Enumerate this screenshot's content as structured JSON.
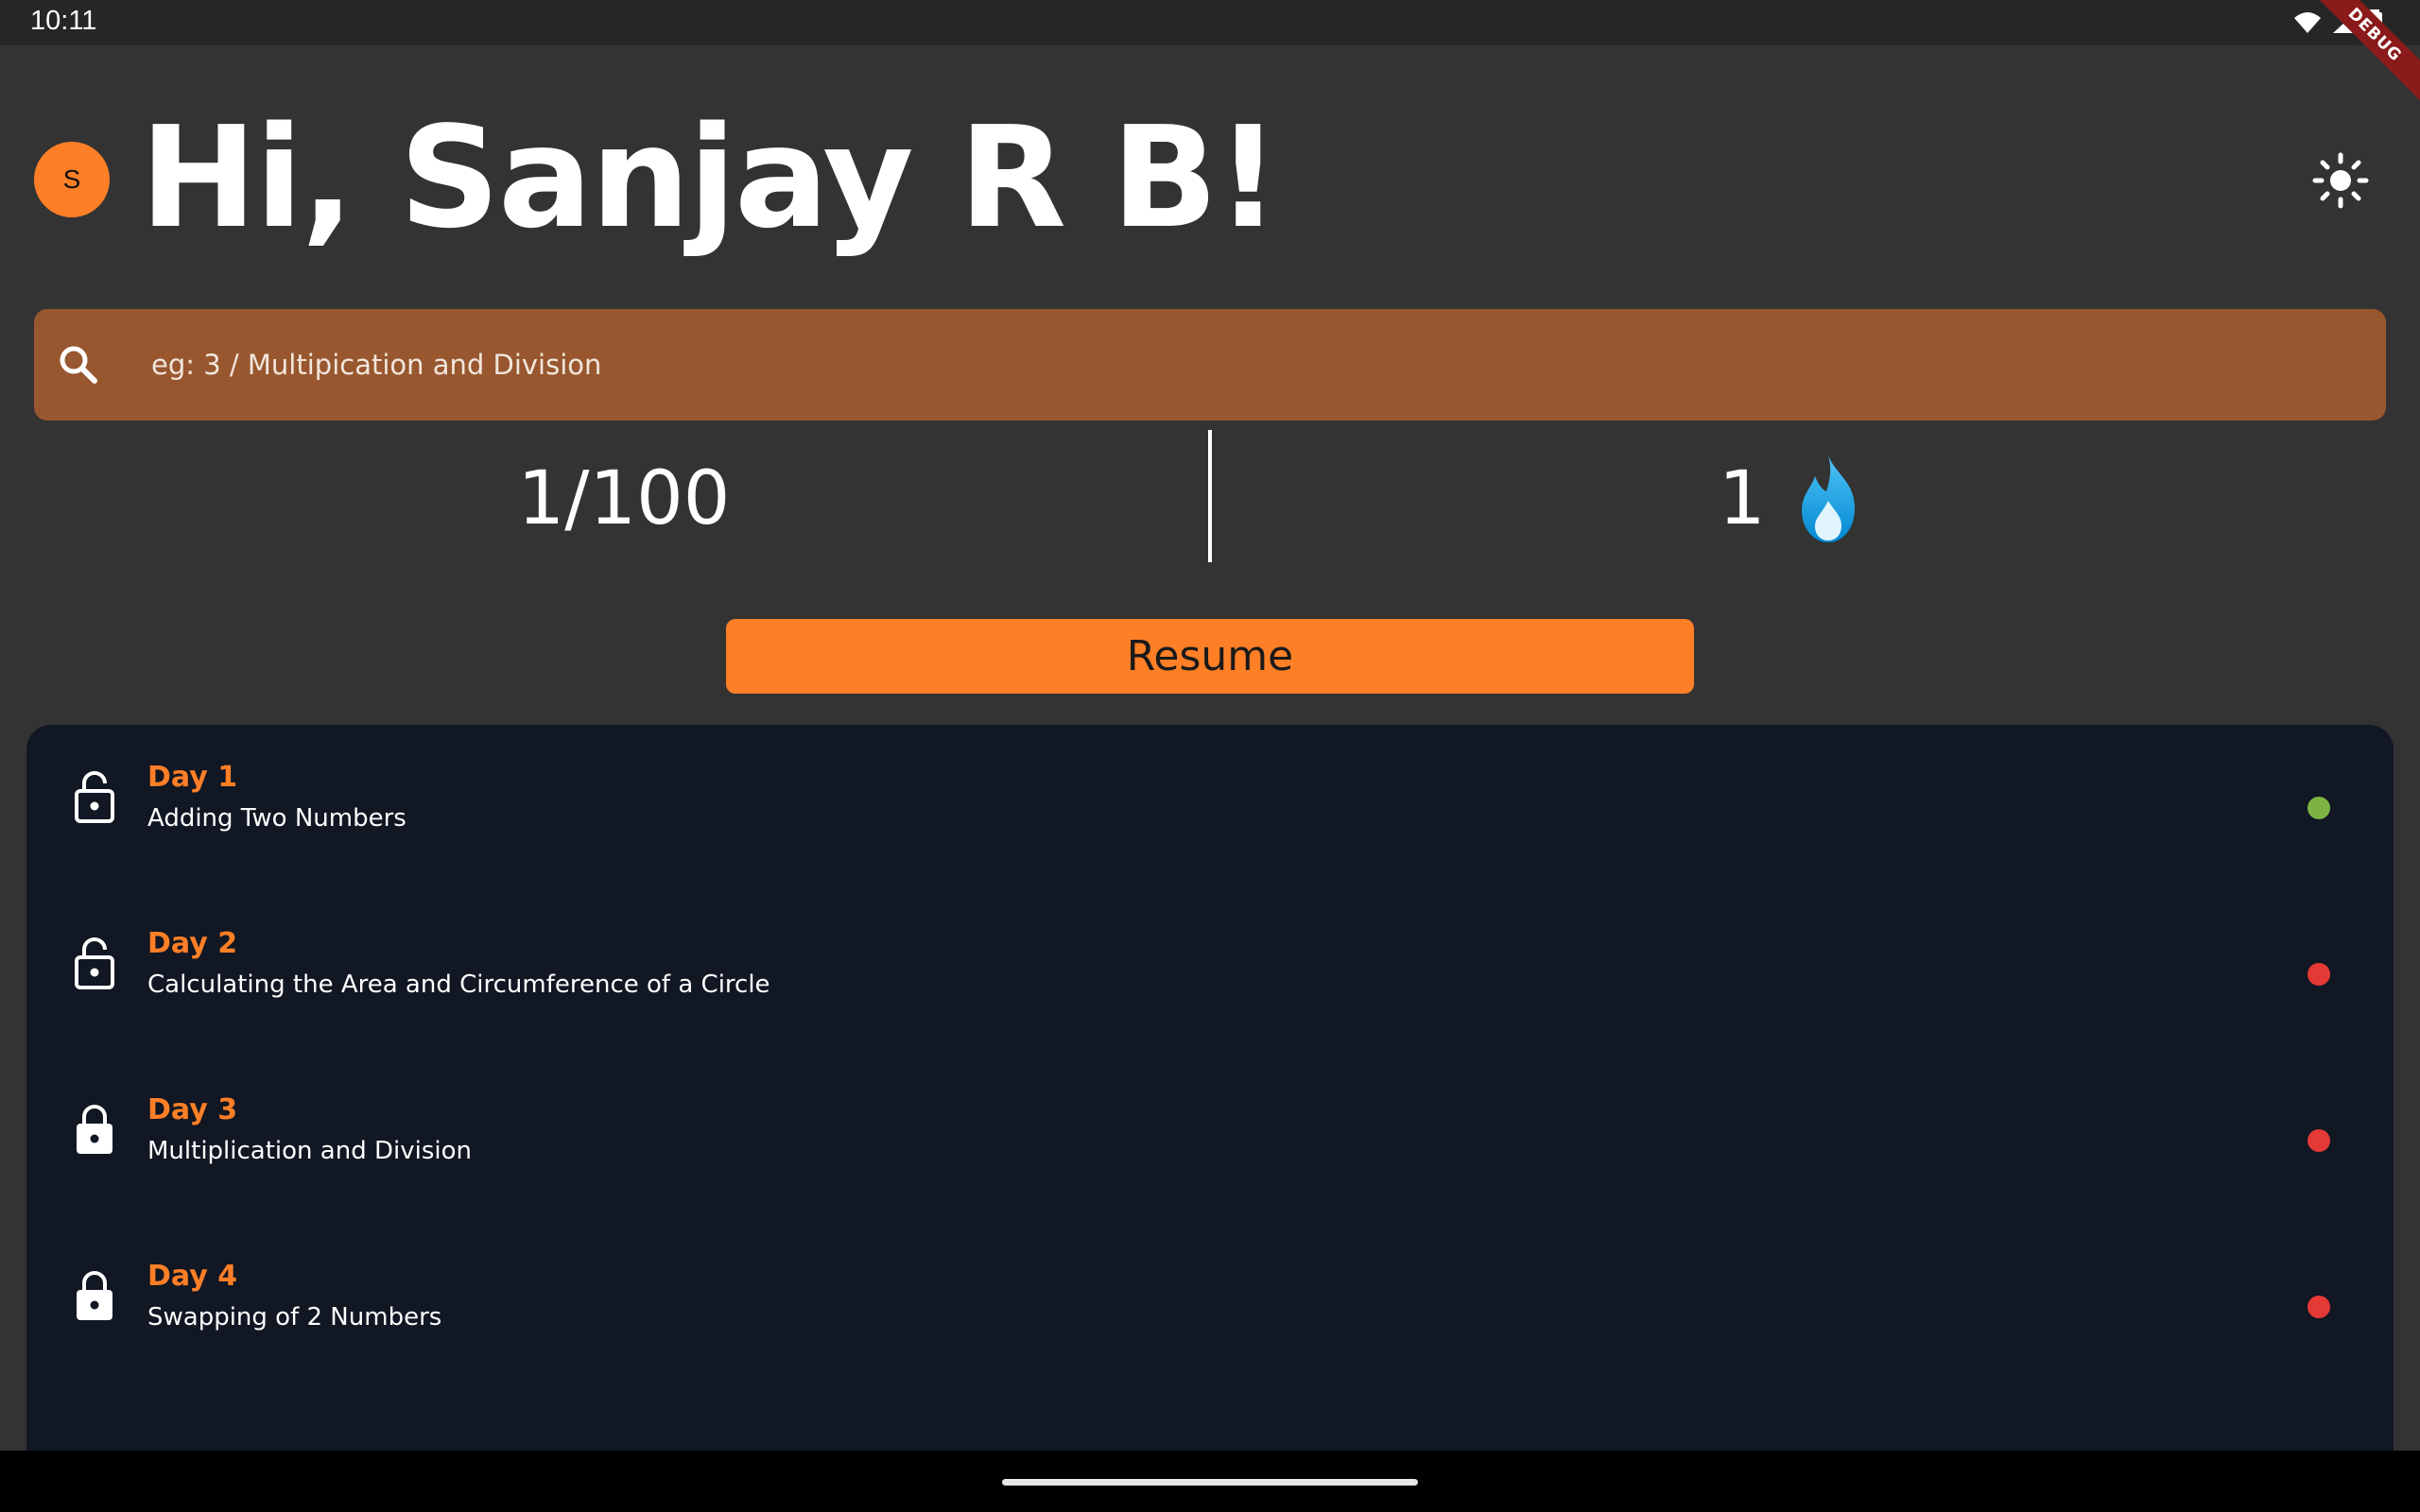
{
  "status_bar": {
    "time": "10:11",
    "icons": [
      "wifi-icon",
      "signal-icon",
      "battery-icon"
    ],
    "debug_label": "DEBUG"
  },
  "header": {
    "avatar_initial": "S",
    "greeting": "Hi, Sanjay R B!",
    "theme_icon": "sun-icon"
  },
  "search": {
    "placeholder": "eg: 3 / Multipication and Division",
    "icon": "search-icon"
  },
  "stats": {
    "progress": "1/100",
    "streak": "1",
    "streak_icon": "fire-icon"
  },
  "resume_label": "Resume",
  "days": [
    {
      "title": "Day 1",
      "subtitle": "Adding Two Numbers",
      "lock": "unlocked",
      "status": "complete"
    },
    {
      "title": "Day 2",
      "subtitle": "Calculating the Area and Circumference of a Circle",
      "lock": "unlocked",
      "status": "incomplete"
    },
    {
      "title": "Day 3",
      "subtitle": "Multiplication and Division",
      "lock": "locked",
      "status": "incomplete"
    },
    {
      "title": "Day 4",
      "subtitle": "Swapping of 2 Numbers",
      "lock": "locked",
      "status": "incomplete"
    }
  ],
  "colors": {
    "accent": "#ff7f27",
    "search_bg": "#98572f",
    "panel_bg": "#111723",
    "page_bg": "#333333",
    "complete": "#7cb342",
    "incomplete": "#e53935"
  }
}
